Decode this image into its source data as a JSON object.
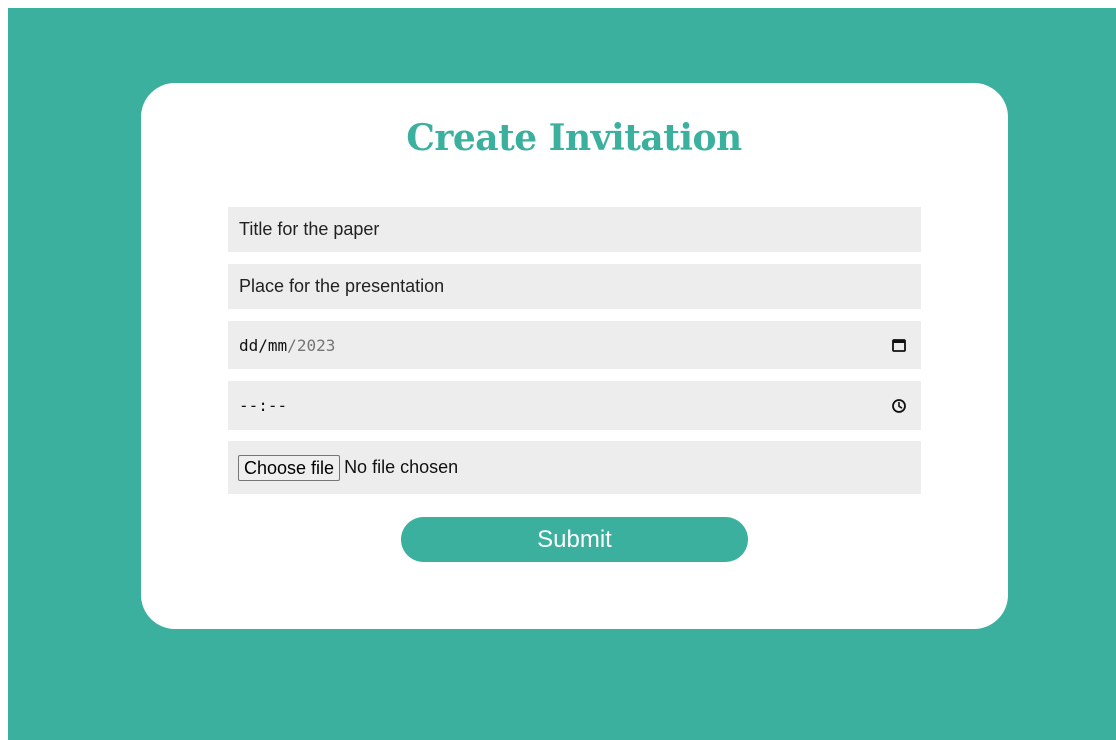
{
  "form": {
    "heading": "Create Invitation",
    "title_input": {
      "placeholder": "Title for the paper",
      "value": ""
    },
    "place_input": {
      "placeholder": "Place for the presentation",
      "value": ""
    },
    "date_input": {
      "day": "dd",
      "sep1": "/",
      "month": "mm",
      "sep2": "/",
      "year": "2023",
      "icon": "calendar-icon"
    },
    "time_input": {
      "display": "--:--",
      "icon": "clock-icon"
    },
    "file_input": {
      "button_label": "Choose file",
      "status": "No file chosen"
    },
    "submit_label": "Submit"
  },
  "colors": {
    "accent": "#3bb09f",
    "card": "#ffffff",
    "field_bg": "#ededed"
  }
}
